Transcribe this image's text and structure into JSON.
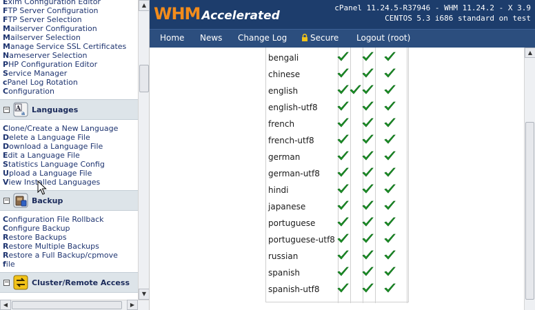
{
  "header": {
    "logo_main": "WHM",
    "logo_sub": "Accelerated",
    "version_line1": "cPanel 11.24.5-R37946 - WHM 11.24.2 - X 3.9",
    "version_line2": "CENTOS 5.3 i686 standard on test"
  },
  "nav": {
    "home": "Home",
    "news": "News",
    "changelog": "Change Log",
    "secure": "Secure",
    "logout": "Logout (root)"
  },
  "sidebar": {
    "top_links": [
      "Exim Configuration Editor",
      "FTP Server Configuration",
      "FTP Server Selection",
      "Mailserver Configuration",
      "Mailserver Selection",
      "Manage Service SSL Certificates",
      "Nameserver Selection",
      "PHP Configuration Editor",
      "Service Manager",
      "cPanel Log Rotation",
      "Configuration"
    ],
    "languages": {
      "title": "Languages",
      "links": [
        "Clone/Create a New Language",
        "Delete a Language File",
        "Download a Language File",
        "Edit a Language File",
        "Statistics Language Config",
        "Upload a Language File",
        "View Installed Languages"
      ]
    },
    "backup": {
      "title": "Backup",
      "links": [
        "Configuration File Rollback",
        "Configure Backup",
        "Restore Backups",
        "Restore Multiple Backups",
        "Restore a Full Backup/cpmove",
        "file"
      ]
    },
    "cluster": {
      "title": "Cluster/Remote Access"
    }
  },
  "languages_table": {
    "rows": [
      {
        "name": "bengali",
        "checks": [
          1,
          0,
          1,
          1
        ]
      },
      {
        "name": "chinese",
        "checks": [
          1,
          0,
          1,
          1
        ]
      },
      {
        "name": "english",
        "checks": [
          1,
          1,
          1,
          1
        ]
      },
      {
        "name": "english-utf8",
        "checks": [
          1,
          0,
          1,
          1
        ]
      },
      {
        "name": "french",
        "checks": [
          1,
          0,
          1,
          1
        ]
      },
      {
        "name": "french-utf8",
        "checks": [
          1,
          0,
          1,
          1
        ]
      },
      {
        "name": "german",
        "checks": [
          1,
          0,
          1,
          1
        ]
      },
      {
        "name": "german-utf8",
        "checks": [
          1,
          0,
          1,
          1
        ]
      },
      {
        "name": "hindi",
        "checks": [
          1,
          0,
          1,
          1
        ]
      },
      {
        "name": "japanese",
        "checks": [
          1,
          0,
          1,
          1
        ]
      },
      {
        "name": "portuguese",
        "checks": [
          1,
          0,
          1,
          1
        ]
      },
      {
        "name": "portuguese-utf8",
        "checks": [
          1,
          0,
          1,
          1
        ]
      },
      {
        "name": "russian",
        "checks": [
          1,
          0,
          1,
          1
        ]
      },
      {
        "name": "spanish",
        "checks": [
          1,
          0,
          1,
          1
        ]
      },
      {
        "name": "spanish-utf8",
        "checks": [
          1,
          0,
          1,
          1
        ]
      }
    ]
  },
  "colors": {
    "header_bg": "#1d3d6c",
    "nav_bg": "#2c4e7e",
    "logo_orange": "#f28c1c",
    "check_green": "#1f9a2a"
  },
  "icons": {
    "check": "check-icon",
    "lock": "lock-icon",
    "languages": "languages-icon",
    "backup": "backup-icon",
    "cluster": "cluster-icon"
  }
}
